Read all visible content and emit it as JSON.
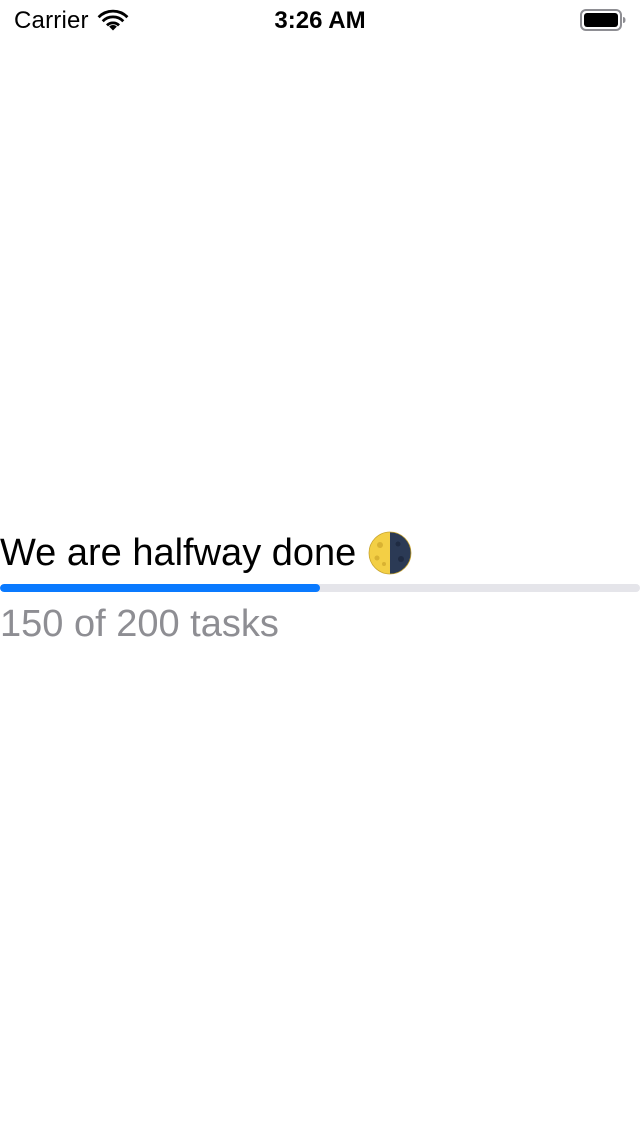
{
  "status_bar": {
    "carrier": "Carrier",
    "time": "3:26 AM",
    "icons": [
      "wifi-icon",
      "battery-icon"
    ]
  },
  "progress": {
    "title": "We are halfway done",
    "title_icon": "first-quarter-moon-icon",
    "subtitle": "150 of 200 tasks",
    "fraction": 0.5,
    "colors": {
      "fill": "#0a7aff",
      "track": "#e5e5ea",
      "subtitle": "#8e8e93"
    }
  }
}
